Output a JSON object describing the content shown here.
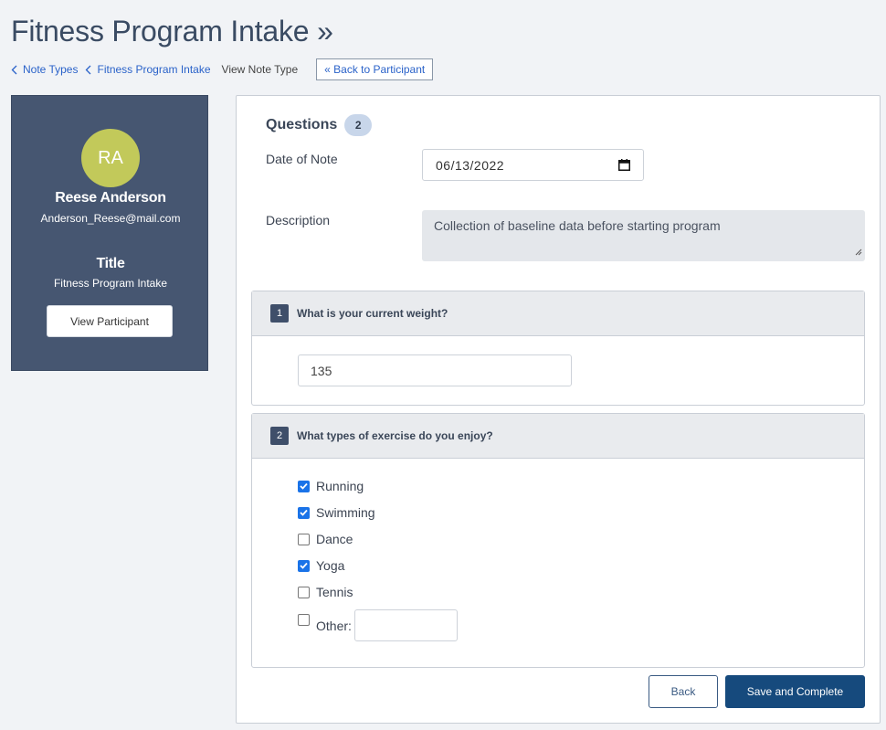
{
  "header": {
    "title": "Fitness Program Intake »"
  },
  "breadcrumb": {
    "items": [
      "Note Types",
      "Fitness Program Intake"
    ],
    "current": "View Note Type",
    "back_link": "« Back to Participant"
  },
  "participant": {
    "initials": "RA",
    "name": "Reese Anderson",
    "email": "Anderson_Reese@mail.com",
    "title_heading": "Title",
    "title_value": "Fitness Program Intake",
    "view_button": "View Participant",
    "avatar_color": "#c2c95a",
    "panel_color": "#465671"
  },
  "form": {
    "questions_label": "Questions",
    "questions_count": "2",
    "date_label": "Date of Note",
    "date_value": "06/13/2022",
    "description_label": "Description",
    "description_value": "Collection of baseline data before starting program",
    "q1": {
      "number": "1",
      "text": "What is your current weight?",
      "answer": "135"
    },
    "q2": {
      "number": "2",
      "text": "What types of exercise do you enjoy?",
      "options": [
        {
          "label": "Running",
          "checked": true
        },
        {
          "label": "Swimming",
          "checked": true
        },
        {
          "label": "Dance",
          "checked": false
        },
        {
          "label": "Yoga",
          "checked": true
        },
        {
          "label": "Tennis",
          "checked": false
        }
      ],
      "other_label": "Other:",
      "other_checked": false
    },
    "back_button": "Back",
    "save_button": "Save and Complete",
    "accent_color": "#164a7d"
  }
}
